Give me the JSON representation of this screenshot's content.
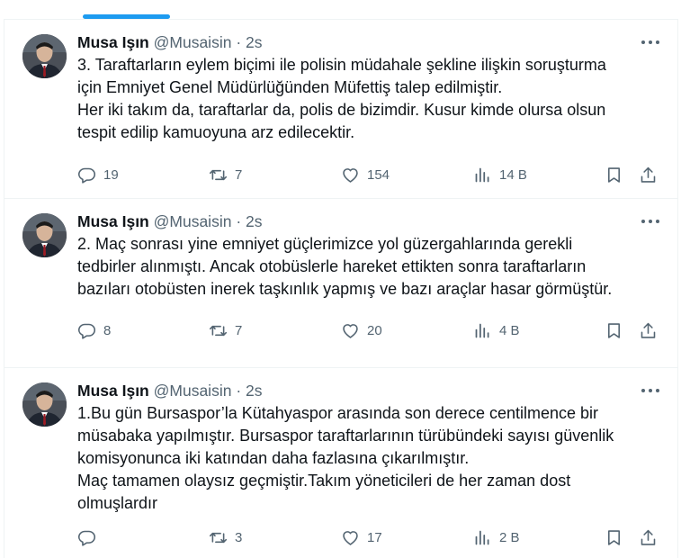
{
  "colors": {
    "accent": "#1d9bf0",
    "text": "#0f1419",
    "muted": "#536471",
    "border": "#eff3f4"
  },
  "tweets": [
    {
      "name": "Musa Işın",
      "handle": "@Musaisin",
      "separator": "·",
      "time": "2s",
      "text": "3. Taraftarların eylem biçimi ile polisin müdahale şekline ilişkin soruşturma\niçin Emniyet Genel Müdürlüğünden Müfettiş talep edilmiştir.\nHer iki takım da, taraftarlar da, polis de bizimdir. Kusur kimde olursa olsun\ntespit edilip kamuoyuna arz edilecektir.",
      "replies": "19",
      "reposts": "7",
      "likes": "154",
      "views": "14 B"
    },
    {
      "name": "Musa Işın",
      "handle": "@Musaisin",
      "separator": "·",
      "time": "2s",
      "text": "2. Maç sonrası yine emniyet güçlerimizce yol güzergahlarında gerekli\ntedbirler alınmıştı. Ancak otobüslerle hareket ettikten sonra taraftarların\nbazıları otobüsten inerek taşkınlık yapmış ve bazı araçlar hasar görmüştür.",
      "replies": "8",
      "reposts": "7",
      "likes": "20",
      "views": "4 B"
    },
    {
      "name": "Musa Işın",
      "handle": "@Musaisin",
      "separator": "·",
      "time": "2s",
      "text": "1.Bu gün Bursaspor’la Kütahyaspor arasında son derece centilmence bir\nmüsabaka yapılmıştır. Bursaspor taraftarlarının türübündeki sayısı güvenlik\nkomisyonunca iki katından daha fazlasına çıkarılmıştır.\nMaç tamamen olaysız geçmiştir.Takım yöneticileri de her zaman dost\nolmuşlardır",
      "replies": "",
      "reposts": "3",
      "likes": "17",
      "views": "2 B"
    }
  ],
  "icons": [
    "reply-icon",
    "repost-icon",
    "like-icon",
    "views-icon",
    "bookmark-icon",
    "share-icon",
    "more-icon"
  ]
}
